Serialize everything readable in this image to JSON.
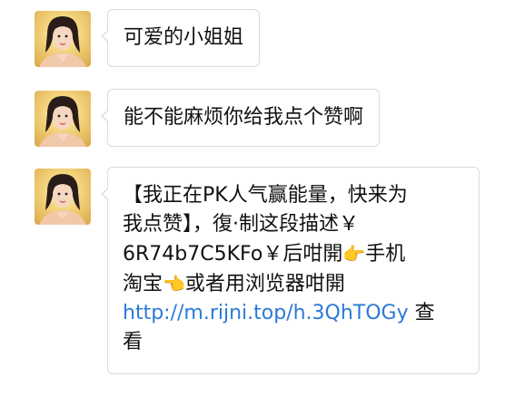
{
  "messages": [
    {
      "text": "可爱的小姐姐"
    },
    {
      "text": "能不能麻烦你给我点个赞啊"
    },
    {
      "lines": [
        "【我正在PK人气赢能量，快来为",
        "我点赞】，復·制这段描述￥",
        "6R74b7C5KFo￥后咁開",
        "手机",
        "淘宝",
        "或者用浏览器咁開",
        "http://m.rijni.top/h.3QhTOGy",
        "查",
        "看"
      ],
      "emoji_right": "👉",
      "emoji_left": "👈",
      "link_color": "#2b7ad8"
    }
  ],
  "colors": {
    "bubble_border": "#dcdcdc",
    "text": "#111111",
    "link": "#2b7ad8"
  },
  "icons": [
    "avatar-girl",
    "hand-pointing-right-icon",
    "hand-pointing-left-icon"
  ]
}
